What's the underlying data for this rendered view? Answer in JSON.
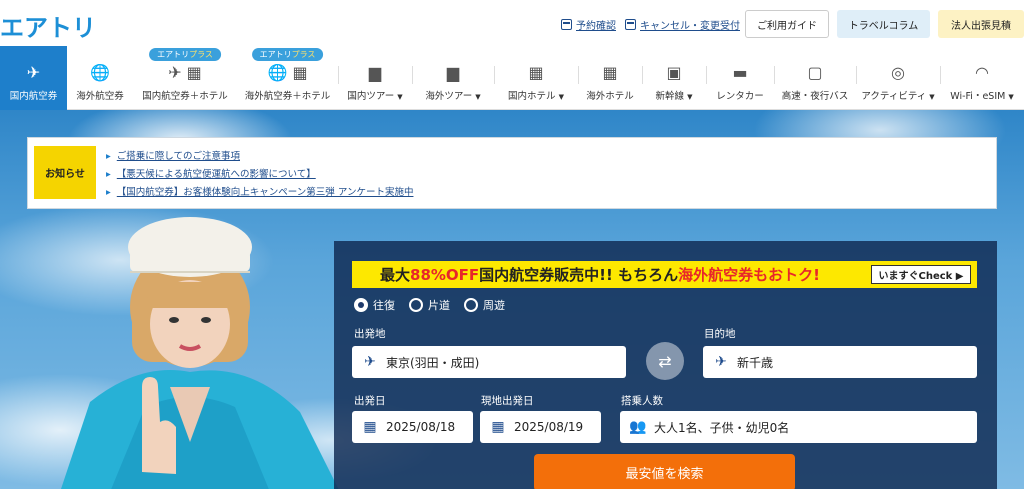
{
  "header": {
    "logo": "エアトリ",
    "links": {
      "reservation": "予約確認",
      "cancel": "キャンセル・変更受付"
    },
    "buttons": {
      "guide": "ご利用ガイド",
      "column": "トラベルコラム",
      "business": "法人出張見積"
    }
  },
  "nav": {
    "badge_prefix": "エアトリ",
    "badge_suffix": "プラス",
    "items": [
      {
        "label": "国内航空券",
        "icon": "airplane-icon"
      },
      {
        "label": "海外航空券",
        "icon": "globe-plane-icon"
      },
      {
        "label": "国内航空券＋ホテル",
        "icon": "plane-hotel-icon"
      },
      {
        "label": "海外航空券＋ホテル",
        "icon": "globe-hotel-icon"
      },
      {
        "label": "国内ツアー",
        "icon": "suitcase-icon"
      },
      {
        "label": "海外ツアー",
        "icon": "suitcase-icon"
      },
      {
        "label": "国内ホテル",
        "icon": "hotel-icon"
      },
      {
        "label": "海外ホテル",
        "icon": "hotel-icon"
      },
      {
        "label": "新幹線",
        "icon": "train-icon"
      },
      {
        "label": "レンタカー",
        "icon": "car-icon"
      },
      {
        "label": "高速・夜行バス",
        "icon": "bus-icon"
      },
      {
        "label": "アクティビティ",
        "icon": "activity-icon"
      },
      {
        "label": "Wi-Fi・eSIM",
        "icon": "wifi-icon"
      }
    ]
  },
  "notice": {
    "label": "お知らせ",
    "items": [
      "ご搭乗に際してのご注意事項",
      "【悪天候による航空便運航への影響について】",
      "【国内航空券】お客様体験向上キャンペーン第三弾 アンケート実施中"
    ]
  },
  "search": {
    "promo": {
      "part1": "最大",
      "part2": "88%OFF",
      "part3": " 国内航空券販売中!! もちろん",
      "part4": "海外航空券もおトク!",
      "button": "いますぐCheck ▶"
    },
    "trip_types": [
      "往復",
      "片道",
      "周遊"
    ],
    "selected_trip": "往復",
    "departure_label": "出発地",
    "departure_value": "東京(羽田・成田)",
    "destination_label": "目的地",
    "destination_value": "新千歳",
    "depart_date_label": "出発日",
    "depart_date_value": "2025/08/18",
    "return_date_label": "現地出発日",
    "return_date_value": "2025/08/19",
    "passengers_label": "搭乗人数",
    "passengers_value": "大人1名、子供・幼児0名",
    "submit": "最安値を検索"
  },
  "colors": {
    "brand_blue": "#1e7fcb",
    "promo_yellow": "#fde800",
    "cta_orange": "#f36f0a",
    "sale_red": "#e8262a"
  }
}
